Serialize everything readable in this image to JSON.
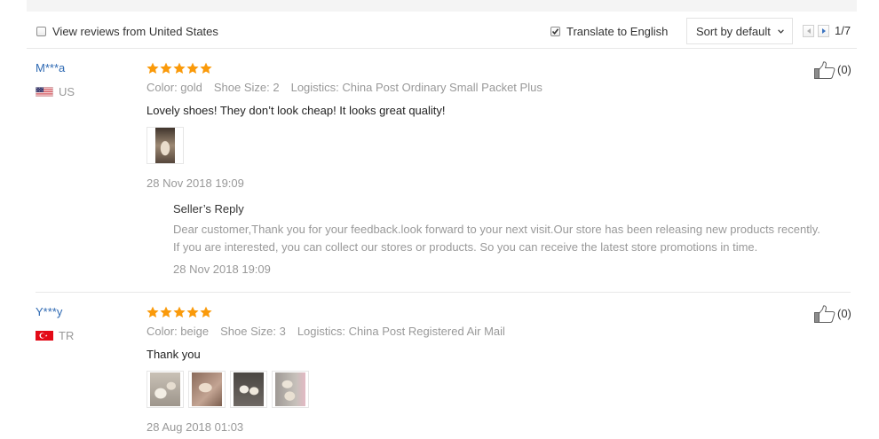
{
  "theme": {
    "star_color": "#fa9a0a",
    "buyer_name_color": "#2f6ab3",
    "pager_active_color": "#3b73c0"
  },
  "toolbar": {
    "local_filter": {
      "label": "View reviews from United States",
      "checked": false
    },
    "translate": {
      "label": "Translate to English",
      "checked": true
    },
    "sort": {
      "selected": "Sort by default",
      "icon": "chevron-down-icon"
    },
    "pagination": {
      "prev_icon": "arrow-left-icon",
      "next_icon": "arrow-right-icon",
      "label": "1/7"
    }
  },
  "reviews": [
    {
      "buyer": "M***a",
      "country": "US",
      "flag_icon": "us-flag-icon",
      "rating": 5,
      "helpful_icon": "thumbs-up-icon",
      "helpful_count": "(0)",
      "attributes": [
        "Color: gold",
        "Shoe Size: 2",
        "Logistics: China Post Ordinary Small Packet Plus"
      ],
      "text": "Lovely shoes! They don’t look cheap! It looks great quality!",
      "photo_count": 1,
      "date": "28 Nov 2018 19:09",
      "seller_reply": {
        "title": "Seller’s Reply",
        "lines": [
          "Dear customer,Thank you for your feedback.look forward to your next visit.Our store has been releasing new products recently.",
          "If you are interested, you can collect our stores or products. So you can receive the latest store promotions in time."
        ],
        "date": "28 Nov 2018 19:09"
      }
    },
    {
      "buyer": "Y***y",
      "country": "TR",
      "flag_icon": "tr-flag-icon",
      "rating": 5,
      "helpful_icon": "thumbs-up-icon",
      "helpful_count": "(0)",
      "attributes": [
        "Color: beige",
        "Shoe Size: 3",
        "Logistics: China Post Registered Air Mail"
      ],
      "text": "Thank you",
      "photo_count": 4,
      "date": "28 Aug 2018 01:03"
    }
  ]
}
